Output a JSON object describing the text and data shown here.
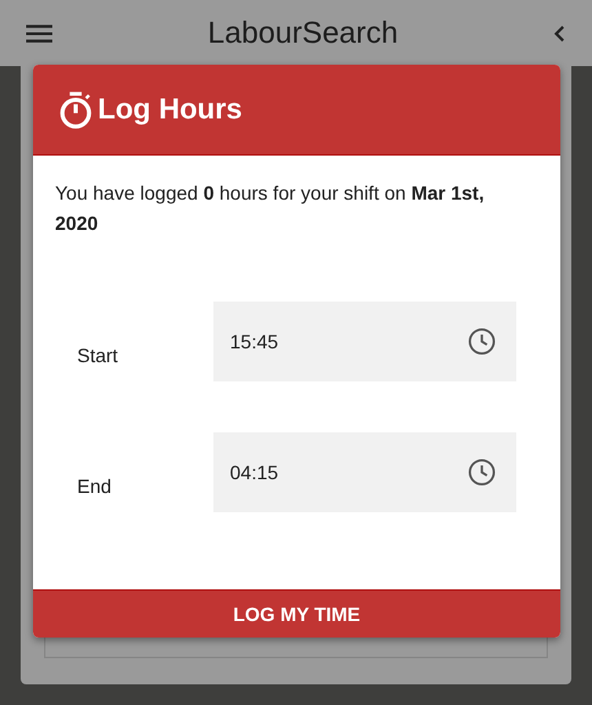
{
  "app_bar": {
    "title": "LabourSearch"
  },
  "dialog": {
    "title": "Log Hours",
    "message": "You have logged **0** hours for your shift on **Mar 1st, 2020**",
    "fields": [
      {
        "label": "Start",
        "value": "15:45"
      },
      {
        "label": "End",
        "value": "04:15"
      }
    ],
    "submit_button": "LOG MY TIME"
  }
}
